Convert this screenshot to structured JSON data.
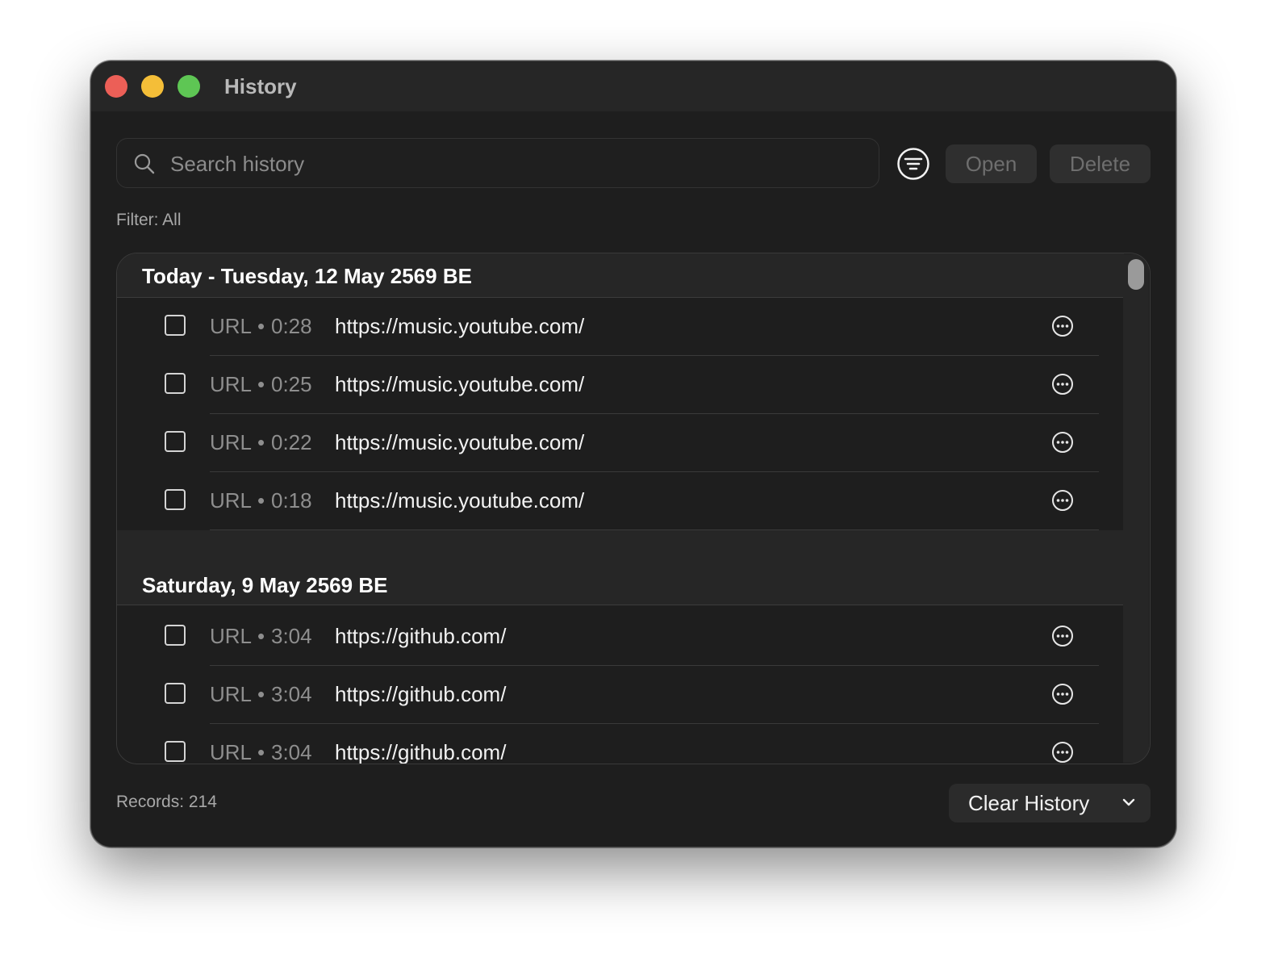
{
  "window": {
    "title": "History"
  },
  "toolbar": {
    "search_placeholder": "Search history",
    "filter_icon": "filter-lines-circle-icon",
    "open_label": "Open",
    "delete_label": "Delete"
  },
  "filter_label": "Filter: All",
  "sections": [
    {
      "title": "Today - Tuesday, 12 May 2569 BE",
      "rows": [
        {
          "kind": "URL",
          "time": "0:28",
          "url": "https://music.youtube.com/"
        },
        {
          "kind": "URL",
          "time": "0:25",
          "url": "https://music.youtube.com/"
        },
        {
          "kind": "URL",
          "time": "0:22",
          "url": "https://music.youtube.com/"
        },
        {
          "kind": "URL",
          "time": "0:18",
          "url": "https://music.youtube.com/"
        }
      ]
    },
    {
      "title": "Saturday, 9 May 2569 BE",
      "rows": [
        {
          "kind": "URL",
          "time": "3:04",
          "url": "https://github.com/"
        },
        {
          "kind": "URL",
          "time": "3:04",
          "url": "https://github.com/"
        },
        {
          "kind": "URL",
          "time": "3:04",
          "url": "https://github.com/"
        }
      ]
    }
  ],
  "separator": "•",
  "footer": {
    "records": "Records: 214",
    "clear_label": "Clear History"
  },
  "colors": {
    "window_bg": "#1e1e1e",
    "close": "#ec5f57",
    "minimize": "#f4be38",
    "maximize": "#5ec654"
  }
}
